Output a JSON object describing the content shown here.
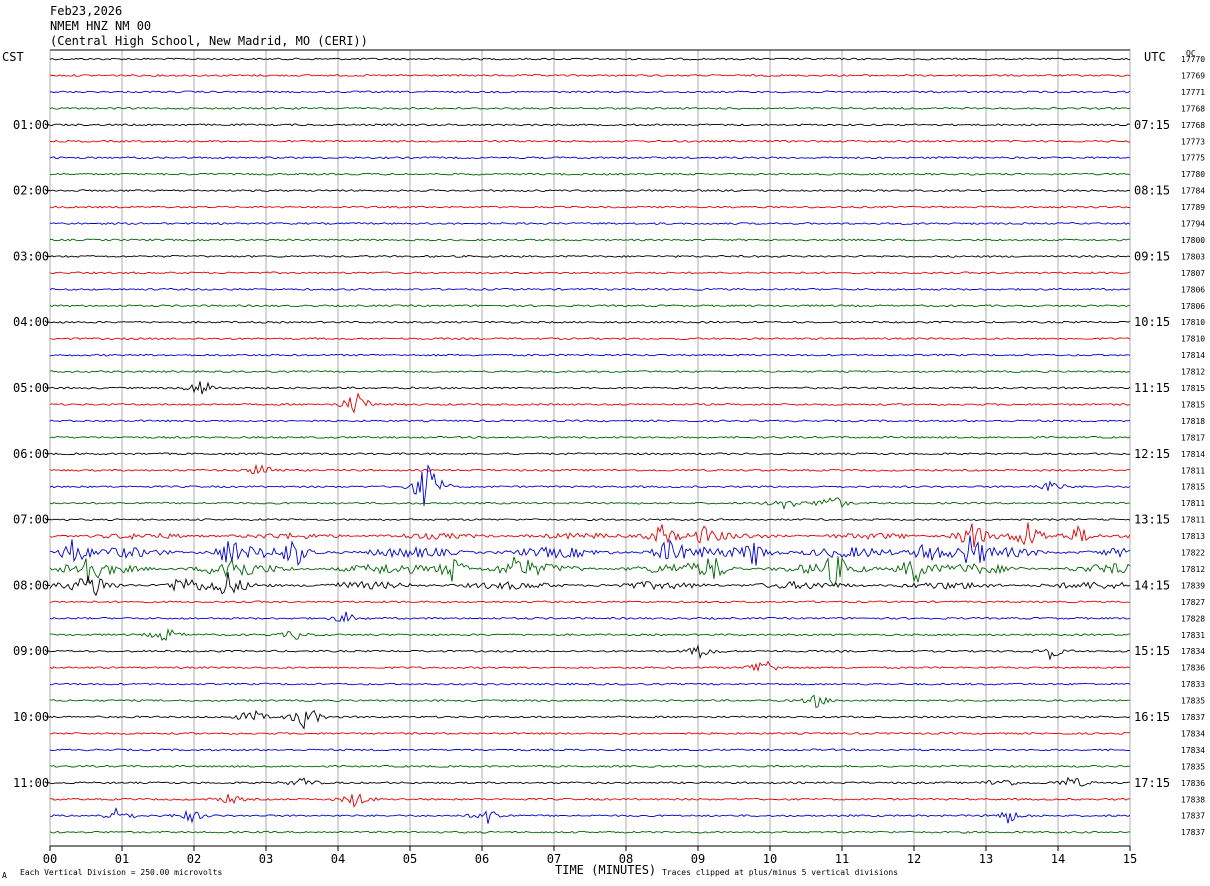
{
  "header": {
    "date": "Feb23,2026",
    "station": "NMEM HNZ NM 00",
    "location": "(Central High School, New Madrid, MO (CERI))"
  },
  "left_tz": "CST",
  "right_tz": "UTC",
  "qc_label": "QC",
  "footer": {
    "scale_note": "Each Vertical Division =  250.00 microvolts",
    "clip_note": "Traces clipped at plus/minus 5 vertical divisions",
    "corner_mark": "A"
  },
  "chart_data": {
    "type": "line",
    "title": "",
    "xlabel": "TIME (MINUTES)",
    "ylabel": "",
    "xlim": [
      0,
      15
    ],
    "x_ticks": [
      "00",
      "01",
      "02",
      "03",
      "04",
      "05",
      "06",
      "07",
      "08",
      "09",
      "10",
      "11",
      "12",
      "13",
      "14",
      "15"
    ],
    "grid": "vertical lines every minute",
    "trace_colors": [
      "#000000",
      "#e00000",
      "#0000d0",
      "#006400"
    ],
    "left_hour_labels": [
      "01:00",
      "02:00",
      "03:00",
      "04:00",
      "05:00",
      "06:00",
      "07:00",
      "08:00",
      "09:00",
      "10:00",
      "11:00"
    ],
    "right_hour_labels": [
      "07:15",
      "08:15",
      "09:15",
      "10:15",
      "11:15",
      "12:15",
      "13:15",
      "14:15",
      "15:15",
      "16:15",
      "17:15"
    ],
    "qc_values": [
      "17770",
      "17769",
      "17771",
      "17768",
      "17768",
      "17773",
      "17775",
      "17780",
      "17784",
      "17789",
      "17794",
      "17800",
      "17803",
      "17807",
      "17806",
      "17806",
      "17810",
      "17810",
      "17814",
      "17812",
      "17815",
      "17815",
      "17818",
      "17817",
      "17814",
      "17811",
      "17815",
      "17811",
      "17811",
      "17813",
      "17822",
      "17812",
      "17839",
      "17827",
      "17828",
      "17831",
      "17834",
      "17836",
      "17833",
      "17835",
      "17837",
      "17834",
      "17834",
      "17835",
      "17836",
      "17838",
      "17837",
      "17837"
    ],
    "trace_count": 48,
    "minutes_per_trace": 15,
    "events": [
      {
        "trace": 20,
        "minute": 2.1,
        "amp": 1.2
      },
      {
        "trace": 21,
        "minute": 4.25,
        "amp": 1.6
      },
      {
        "trace": 25,
        "minute": 2.95,
        "amp": 1.0
      },
      {
        "trace": 26,
        "minute": 5.25,
        "amp": 3.5
      },
      {
        "trace": 26,
        "minute": 13.9,
        "amp": 0.8
      },
      {
        "trace": 27,
        "minute": 10.2,
        "amp": 0.9
      },
      {
        "trace": 27,
        "minute": 10.85,
        "amp": 1.3
      },
      {
        "trace": 29,
        "minute": 8.5,
        "amp": 1.6
      },
      {
        "trace": 29,
        "minute": 9.1,
        "amp": 1.0
      },
      {
        "trace": 29,
        "minute": 12.8,
        "amp": 2.2
      },
      {
        "trace": 29,
        "minute": 13.6,
        "amp": 1.6
      },
      {
        "trace": 29,
        "minute": 14.3,
        "amp": 1.2
      },
      {
        "trace": 30,
        "minute": 0.3,
        "amp": 1.6
      },
      {
        "trace": 30,
        "minute": 2.5,
        "amp": 1.8
      },
      {
        "trace": 30,
        "minute": 3.4,
        "amp": 1.6
      },
      {
        "trace": 30,
        "minute": 8.6,
        "amp": 1.5
      },
      {
        "trace": 30,
        "minute": 9.8,
        "amp": 1.8
      },
      {
        "trace": 30,
        "minute": 12.2,
        "amp": 2.0
      },
      {
        "trace": 30,
        "minute": 12.8,
        "amp": 2.0
      },
      {
        "trace": 31,
        "minute": 0.5,
        "amp": 1.8
      },
      {
        "trace": 31,
        "minute": 2.5,
        "amp": 2.0
      },
      {
        "trace": 31,
        "minute": 5.6,
        "amp": 1.8
      },
      {
        "trace": 31,
        "minute": 6.5,
        "amp": 1.5
      },
      {
        "trace": 31,
        "minute": 9.2,
        "amp": 1.5
      },
      {
        "trace": 31,
        "minute": 10.9,
        "amp": 1.6
      },
      {
        "trace": 31,
        "minute": 12.0,
        "amp": 2.2
      },
      {
        "trace": 32,
        "minute": 0.6,
        "amp": 1.6
      },
      {
        "trace": 32,
        "minute": 1.85,
        "amp": 1.4
      },
      {
        "trace": 32,
        "minute": 2.45,
        "amp": 1.5
      },
      {
        "trace": 34,
        "minute": 4.1,
        "amp": 0.7
      },
      {
        "trace": 35,
        "minute": 1.6,
        "amp": 1.0
      },
      {
        "trace": 35,
        "minute": 3.4,
        "amp": 0.6
      },
      {
        "trace": 36,
        "minute": 9.05,
        "amp": 0.9
      },
      {
        "trace": 36,
        "minute": 13.9,
        "amp": 0.9
      },
      {
        "trace": 37,
        "minute": 9.9,
        "amp": 1.4
      },
      {
        "trace": 39,
        "minute": 10.65,
        "amp": 0.8
      },
      {
        "trace": 40,
        "minute": 2.8,
        "amp": 1.0
      },
      {
        "trace": 40,
        "minute": 3.55,
        "amp": 1.8
      },
      {
        "trace": 44,
        "minute": 3.5,
        "amp": 0.7
      },
      {
        "trace": 44,
        "minute": 13.2,
        "amp": 0.8
      },
      {
        "trace": 44,
        "minute": 14.2,
        "amp": 0.9
      },
      {
        "trace": 45,
        "minute": 2.5,
        "amp": 0.6
      },
      {
        "trace": 45,
        "minute": 4.25,
        "amp": 1.0
      },
      {
        "trace": 46,
        "minute": 0.95,
        "amp": 1.0
      },
      {
        "trace": 46,
        "minute": 1.95,
        "amp": 0.8
      },
      {
        "trace": 46,
        "minute": 6.1,
        "amp": 1.0
      },
      {
        "trace": 46,
        "minute": 13.3,
        "amp": 0.9
      }
    ],
    "noisy_traces": [
      {
        "trace": 29,
        "level": 0.45
      },
      {
        "trace": 30,
        "level": 0.9
      },
      {
        "trace": 31,
        "level": 0.9
      },
      {
        "trace": 32,
        "level": 0.6
      }
    ]
  }
}
